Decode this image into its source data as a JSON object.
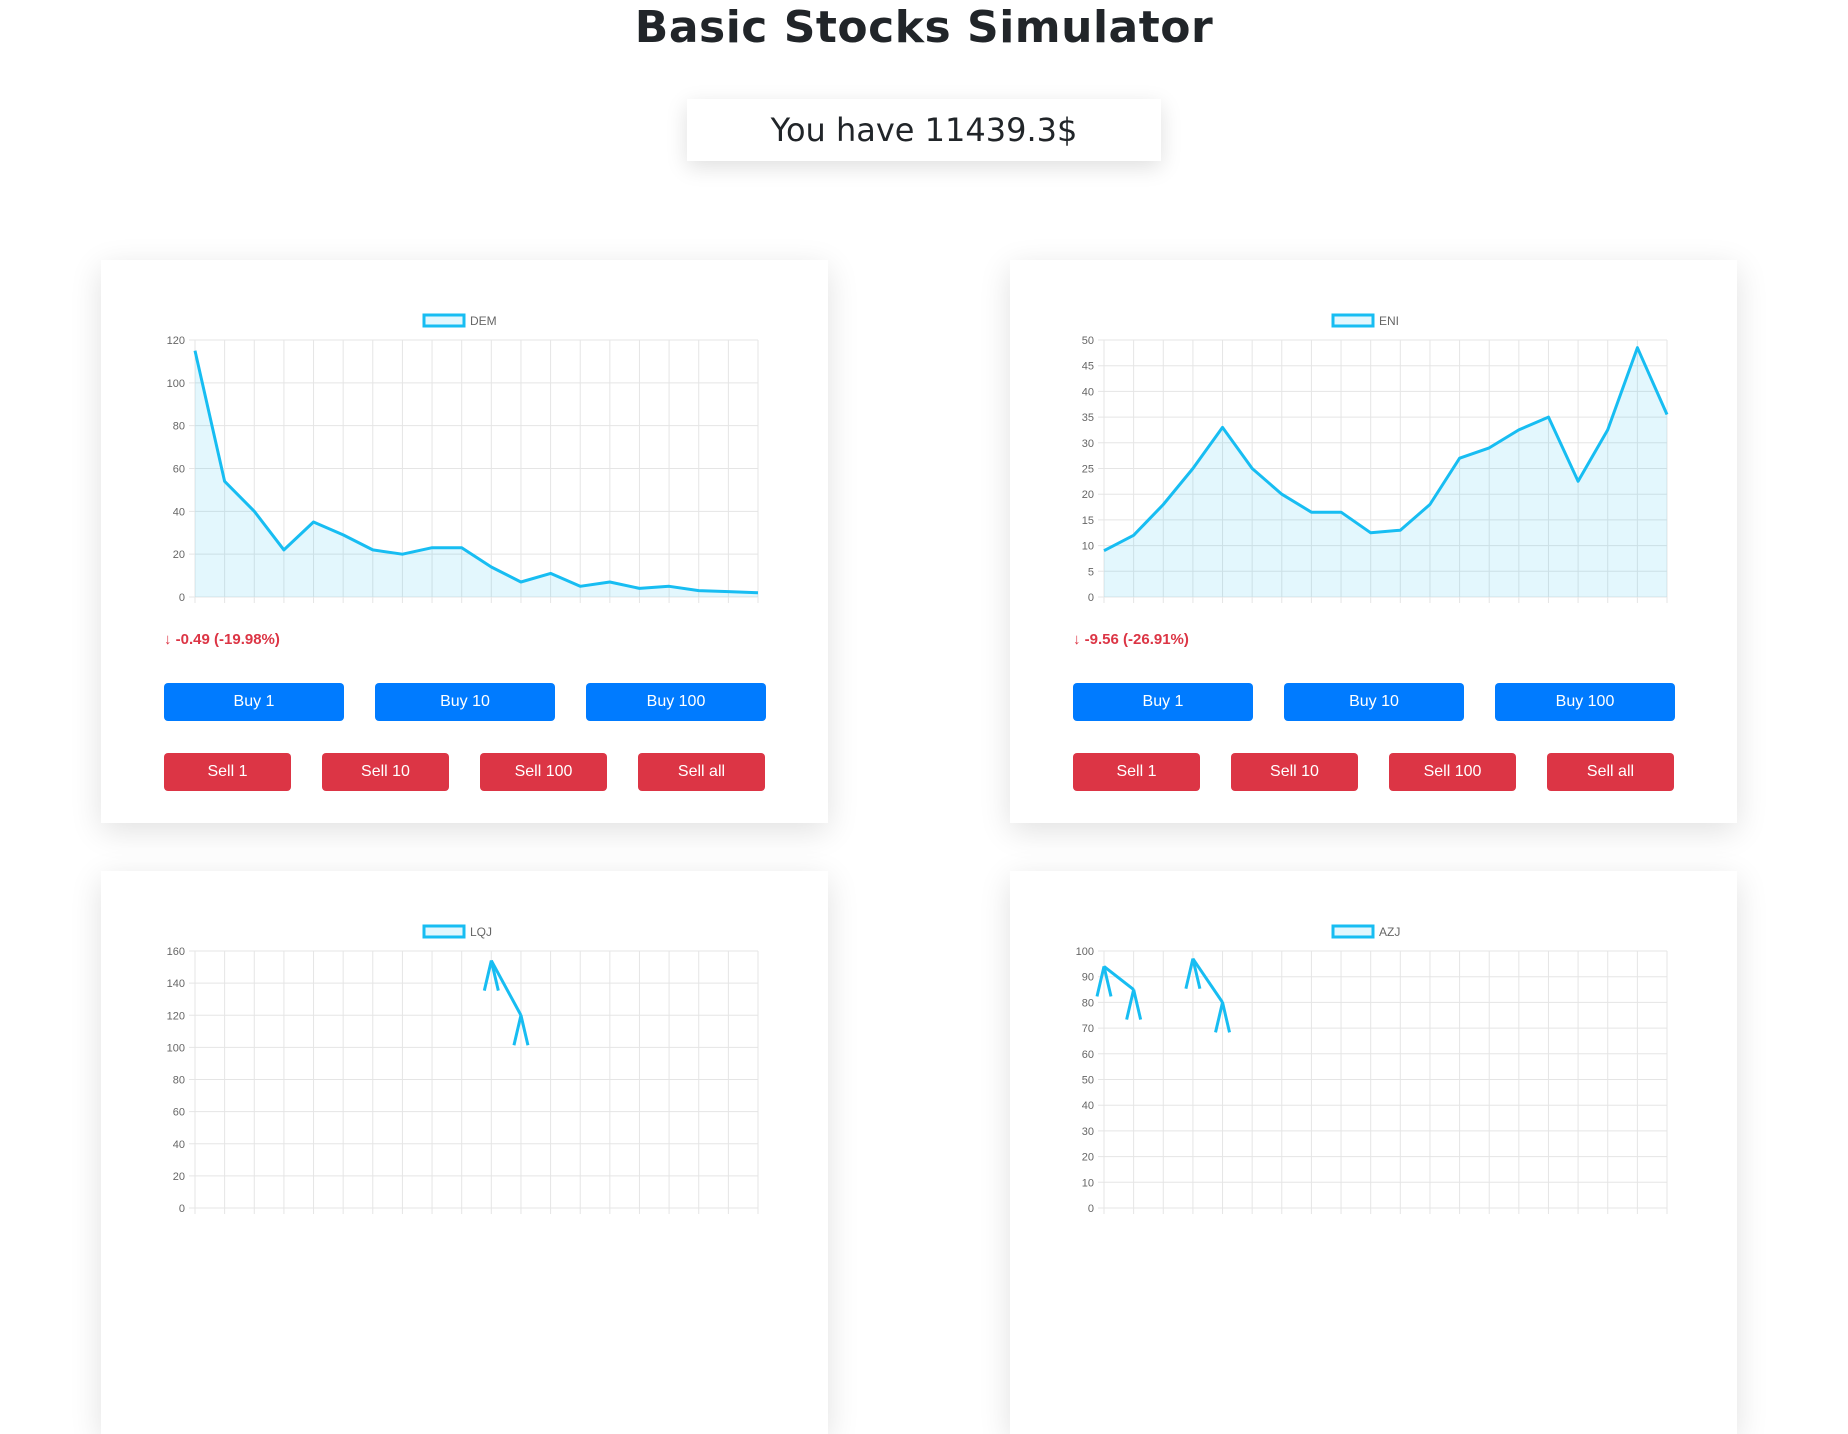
{
  "page": {
    "title": "Basic Stocks Simulator",
    "balance_text": "You have 11439.3$"
  },
  "colors": {
    "buy": "#007bff",
    "sell": "#dc3545",
    "line": "#17bdf2",
    "fill": "rgba(23,189,242,0.12)",
    "grid": "#e5e5e5",
    "down": "#dc3545"
  },
  "stocks": [
    {
      "name": "DEM",
      "change_text": "↓ -0.49 (-19.98%)",
      "buttons": {
        "buy": [
          "Buy 1",
          "Buy 10",
          "Buy 100"
        ],
        "sell": [
          "Sell 1",
          "Sell 10",
          "Sell 100",
          "Sell all"
        ]
      },
      "chart_data": {
        "type": "line",
        "series": [
          {
            "name": "DEM",
            "values": [
              115,
              54,
              40,
              22,
              35,
              29,
              22,
              20,
              23,
              23,
              14,
              7,
              11,
              5,
              7,
              4,
              5,
              3,
              2.5,
              2
            ]
          }
        ],
        "ylim": [
          0,
          120
        ],
        "yticks": [
          0,
          20,
          40,
          60,
          80,
          100,
          120
        ],
        "grid": true,
        "legend": "top-center"
      }
    },
    {
      "name": "ENI",
      "change_text": "↓ -9.56 (-26.91%)",
      "buttons": {
        "buy": [
          "Buy 1",
          "Buy 10",
          "Buy 100"
        ],
        "sell": [
          "Sell 1",
          "Sell 10",
          "Sell 100",
          "Sell all"
        ]
      },
      "chart_data": {
        "type": "line",
        "series": [
          {
            "name": "ENI",
            "values": [
              9,
              12,
              18,
              25,
              33,
              25,
              20,
              16.5,
              16.5,
              12.5,
              13,
              18,
              27,
              29,
              32.5,
              35,
              22.5,
              32.5,
              48.5,
              35.5
            ]
          }
        ],
        "ylim": [
          0,
          50
        ],
        "yticks": [
          0,
          5,
          10,
          15,
          20,
          25,
          30,
          35,
          40,
          45,
          50
        ],
        "grid": true,
        "legend": "top-center"
      }
    },
    {
      "name": "LQJ",
      "change_text": "",
      "buttons": {
        "buy": [],
        "sell": []
      },
      "chart_data": {
        "type": "line",
        "series": [
          {
            "name": "LQJ",
            "values": [
              null,
              null,
              null,
              null,
              null,
              null,
              null,
              null,
              null,
              null,
              154,
              120
            ]
          }
        ],
        "ylim": [
          0,
          160
        ],
        "yticks": [
          0,
          20,
          40,
          60,
          80,
          100,
          120,
          140,
          160
        ],
        "grid": true,
        "legend": "top-center"
      }
    },
    {
      "name": "AZJ",
      "change_text": "",
      "buttons": {
        "buy": [],
        "sell": []
      },
      "chart_data": {
        "type": "line",
        "series": [
          {
            "name": "AZJ",
            "values": [
              94,
              85,
              null,
              97,
              80
            ]
          }
        ],
        "ylim": [
          0,
          100
        ],
        "yticks": [
          0,
          10,
          20,
          30,
          40,
          50,
          60,
          70,
          80,
          90,
          100
        ],
        "grid": true,
        "legend": "top-center"
      }
    }
  ]
}
